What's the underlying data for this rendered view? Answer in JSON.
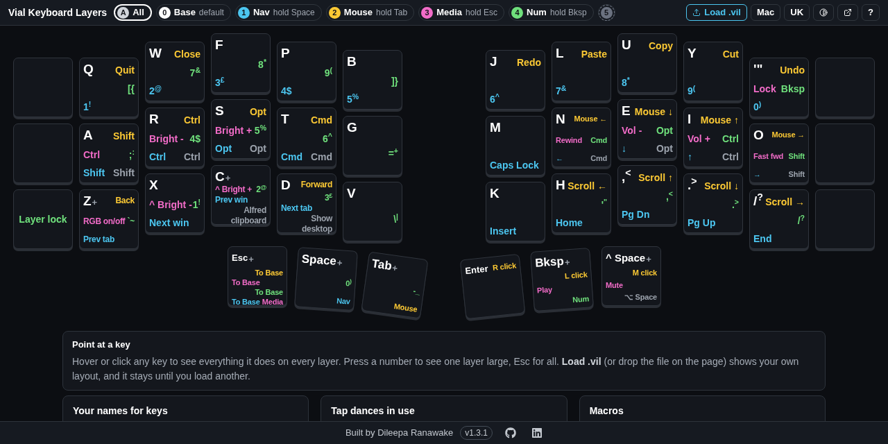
{
  "app_title": "Vial Keyboard Layers",
  "layers": [
    {
      "kind": "all",
      "badge": "A",
      "name": "All",
      "selected": true
    },
    {
      "kind": "base",
      "badge": "0",
      "name": "Base",
      "hint": "default",
      "selected": false
    },
    {
      "kind": "nav",
      "badge": "1",
      "name": "Nav",
      "hint": "hold Space",
      "selected": false
    },
    {
      "kind": "mouse",
      "badge": "2",
      "name": "Mouse",
      "hint": "hold Tab",
      "selected": false
    },
    {
      "kind": "media",
      "badge": "3",
      "name": "Media",
      "hint": "hold Esc",
      "selected": false
    },
    {
      "kind": "num",
      "badge": "4",
      "name": "Num",
      "hint": "hold Bksp",
      "selected": false
    },
    {
      "kind": "extra",
      "badge": "5",
      "selected": false
    }
  ],
  "toolbar": {
    "load": "Load .vil",
    "os": "Mac",
    "locale": "UK",
    "help": "?"
  },
  "keys": [
    {
      "kind": "blank"
    },
    {
      "kind": "key",
      "legend": "Q",
      "mouse": "Quit",
      "num": "[{",
      "nav": "1$^{!}$"
    },
    {
      "kind": "key",
      "legend": "W",
      "mouse": "Close",
      "num": "7$^{&}$",
      "nav": "2$^{@}$"
    },
    {
      "kind": "key",
      "legend": "F",
      "num": "8$^{*}$",
      "nav": "3$^{£}$"
    },
    {
      "kind": "key",
      "legend": "P",
      "num": "9$^{(}$",
      "nav": "4$"
    },
    {
      "kind": "key",
      "legend": "B",
      "num": "]}",
      "nav": "5$^{%}$"
    },
    {
      "kind": "key",
      "legend": "J",
      "mouse": "Redo",
      "nav": "6$^{^}$"
    },
    {
      "kind": "key",
      "legend": "L",
      "mouse": "Paste",
      "nav": "7$^{&}$"
    },
    {
      "kind": "key",
      "legend": "U",
      "mouse": "Copy",
      "nav": "8$^{*}$"
    },
    {
      "kind": "key",
      "legend": "Y",
      "mouse": "Cut",
      "nav": "9$^{(}$"
    },
    {
      "kind": "key",
      "legend": "'\"",
      "mouse": "Undo",
      "media": "Lock",
      "num": "Bksp",
      "nav": "0$^{)}$"
    },
    {
      "kind": "blank"
    },
    {
      "kind": "blank"
    },
    {
      "kind": "key",
      "legend": "A",
      "mouse": "Shift",
      "media": "Ctrl",
      "num": ";$^{:}$",
      "nav": "Shift",
      "hold": {
        "text": "Shift",
        "color": "#9ca3ad"
      }
    },
    {
      "kind": "key",
      "legend": "R",
      "mouse": "Ctrl",
      "media": "Bright -",
      "num": "4$",
      "nav": "Ctrl",
      "hold": {
        "text": "Ctrl",
        "color": "#9ca3ad"
      }
    },
    {
      "kind": "key",
      "legend": "S",
      "mouse": "Opt",
      "media": "Bright +",
      "num": "5$^{%}$",
      "nav": "Opt",
      "hold": {
        "text": "Opt",
        "color": "#9ca3ad"
      }
    },
    {
      "kind": "key",
      "legend": "T",
      "mouse": "Cmd",
      "num": "6$^{^}$",
      "nav": "Cmd",
      "hold": {
        "text": "Cmd",
        "color": "#9ca3ad"
      }
    },
    {
      "kind": "key",
      "legend": "G",
      "num": "=$^{+}$"
    },
    {
      "kind": "key",
      "legend": "M",
      "nav": "Caps Lock"
    },
    {
      "kind": "key",
      "legend": "N",
      "mouse": "Mouse ←",
      "media": "Rewind",
      "num": "Cmd",
      "nav": "←",
      "hold": {
        "text": "Cmd",
        "color": "#9ca3ad"
      }
    },
    {
      "kind": "key",
      "legend": "E",
      "mouse": "Mouse ↓",
      "media": "Vol -",
      "num": "Opt",
      "nav": "↓",
      "hold": {
        "text": "Opt",
        "color": "#9ca3ad"
      }
    },
    {
      "kind": "key",
      "legend": "I",
      "mouse": "Mouse ↑",
      "media": "Vol +",
      "num": "Ctrl",
      "nav": "↑",
      "hold": {
        "text": "Ctrl",
        "color": "#9ca3ad"
      }
    },
    {
      "kind": "key",
      "legend": "O",
      "mouse": "Mouse →",
      "media": "Fast fwd",
      "num": "Shift",
      "nav": "→",
      "hold": {
        "text": "Shift",
        "color": "#9ca3ad"
      }
    },
    {
      "kind": "blank"
    },
    {
      "kind": "key",
      "num": "Layer lock"
    },
    {
      "kind": "key",
      "legend": "Z",
      "plus": "+",
      "mouse": "Back",
      "media": "RGB on/off",
      "num": "`~",
      "nav": "Prev tab"
    },
    {
      "kind": "key",
      "legend": "X",
      "media": "^ Bright -",
      "num": "1$^{!}$",
      "nav": "Next win"
    },
    {
      "kind": "key",
      "legend": "C",
      "plus": "+",
      "media": "^ Bright +",
      "num": "2$^{@}$",
      "nav": "Prev win",
      "hold": {
        "text": "Alfred clipboard",
        "color": "#9ca3ad"
      }
    },
    {
      "kind": "key",
      "legend": "D",
      "mouse": "Forward",
      "num": "3$^{£}$",
      "nav": "Next tab",
      "hold": {
        "text": "Show desktop",
        "color": "#9ca3ad"
      }
    },
    {
      "kind": "key",
      "legend": "V",
      "num": "\\$^{|}$"
    },
    {
      "kind": "key",
      "legend": "K",
      "nav": "Insert"
    },
    {
      "kind": "key",
      "legend": "H",
      "mouse": "Scroll ←",
      "num": "'$^{\"}$",
      "nav": "Home"
    },
    {
      "kind": "key",
      "legend": ",$^{<}$",
      "mouse": "Scroll ↑",
      "num": ",$^{<}$",
      "nav": "Pg Dn"
    },
    {
      "kind": "key",
      "legend": ".$^{>}$",
      "mouse": "Scroll ↓",
      "num": ".$^{>}$",
      "nav": "Pg Up"
    },
    {
      "kind": "key",
      "legend": "/$^{?}$",
      "mouse": "Scroll →",
      "num": "/$^{?}$",
      "nav": "End"
    },
    {
      "kind": "blank"
    },
    {
      "kind": "key",
      "legend": "Esc",
      "plus": "+",
      "mouse": "To Base",
      "media": "To Base",
      "num": "To Base",
      "nav": "To Base",
      "hold": {
        "text": "Media",
        "color": "#f26cc8"
      }
    },
    {
      "kind": "key",
      "legend": "Space",
      "plus": "+",
      "num": "0$^{)}$",
      "hold": {
        "text": "Nav",
        "color": "#4cc6f0"
      }
    },
    {
      "kind": "key",
      "legend": "Tab",
      "plus": "+",
      "num": "-_",
      "hold": {
        "text": "Mouse",
        "color": "#fcc934"
      }
    },
    {
      "kind": "key",
      "legend": "Enter",
      "mouse": "R click"
    },
    {
      "kind": "key",
      "legend": "Bksp",
      "plus": "+",
      "mouse": "L click",
      "media": "Play",
      "hold": {
        "text": "Num",
        "color": "#6fe07c"
      }
    },
    {
      "kind": "key",
      "legend": "^ Space",
      "plus": "+",
      "mouse": "M click",
      "media": "Mute",
      "hold": {
        "text": "⌥ Space",
        "color": "#9ca3ad"
      }
    }
  ],
  "info": {
    "title": "Point at a key",
    "text": "Hover or click any key to see everything it does on every layer. Press a number to see one layer large, Esc for all. **Load .vil** (or drop the file on the page) shows your own layout, and it stays until you load another."
  },
  "cards": [
    "Your names for keys",
    "Tap dances in use",
    "Macros"
  ],
  "footer": {
    "credit": "Built by Dileepa Ranawake",
    "version": "v1.3.1"
  }
}
